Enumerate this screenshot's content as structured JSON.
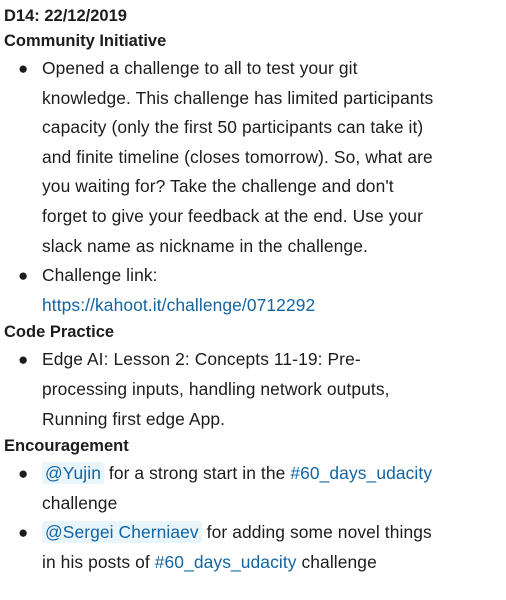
{
  "day_heading": "D14: 22/12/2019",
  "sections": {
    "community": {
      "title": "Community Initiative",
      "bullet1_lines": [
        "Opened a challenge to all to test your git",
        "knowledge. This challenge has limited participants",
        "capacity (only the first 50 participants can take it)",
        "and finite timeline (closes tomorrow). So, what are",
        "you waiting for? Take the challenge and don't",
        "forget to give your feedback at the end. Use your",
        "slack name as nickname in the challenge."
      ],
      "bullet2_label": "Challenge link:",
      "bullet2_link": "https://kahoot.it/challenge/0712292"
    },
    "code_practice": {
      "title": "Code Practice",
      "bullet_lines": [
        "Edge AI: Lesson 2: Concepts 11-19: Pre-",
        "processing inputs, handling network outputs,",
        "Running first edge App."
      ]
    },
    "encouragement": {
      "title": "Encouragement",
      "item1": {
        "mention": "@Yujin",
        "text_before_tag": " for a strong start in the ",
        "hashtag": "#60_days_udacity",
        "line2": "challenge"
      },
      "item2": {
        "mention": "@Sergei Cherniaev",
        "text_after_mention": " for adding some novel things",
        "line2_before_tag": "in his posts of ",
        "hashtag": "#60_days_udacity",
        "line2_after_tag": " challenge"
      }
    }
  },
  "colors": {
    "link": "#1264a3",
    "mention_bg": "#e8f5fa",
    "text": "#1d1c1d"
  }
}
